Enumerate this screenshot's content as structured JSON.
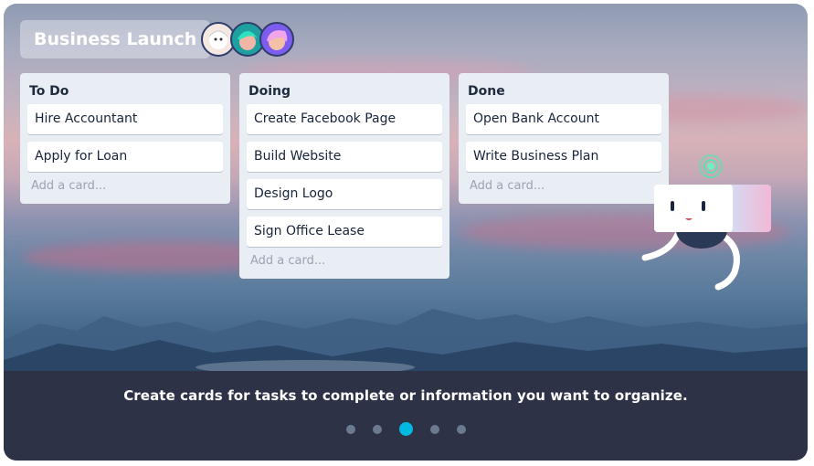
{
  "board": {
    "title": "Business Launch",
    "members": [
      "member-1",
      "member-2",
      "member-3"
    ]
  },
  "lists": [
    {
      "title": "To Do",
      "cards": [
        "Hire Accountant",
        "Apply for Loan"
      ],
      "add_label": "Add a card..."
    },
    {
      "title": "Doing",
      "cards": [
        "Create Facebook Page",
        "Build Website",
        "Design Logo",
        "Sign Office Lease"
      ],
      "add_label": "Add a card..."
    },
    {
      "title": "Done",
      "cards": [
        "Open Bank Account",
        "Write Business Plan"
      ],
      "add_label": "Add a card..."
    }
  ],
  "caption": "Create cards for tasks to complete or information you want to organize.",
  "carousel": {
    "count": 5,
    "active_index": 2
  },
  "colors": {
    "accent": "#00b8e0",
    "caption_band": "#2d3246",
    "list_bg": "#e9edf4"
  },
  "icons": {
    "mascot": "robot-mascot-icon",
    "signal": "signal-ring-icon"
  }
}
